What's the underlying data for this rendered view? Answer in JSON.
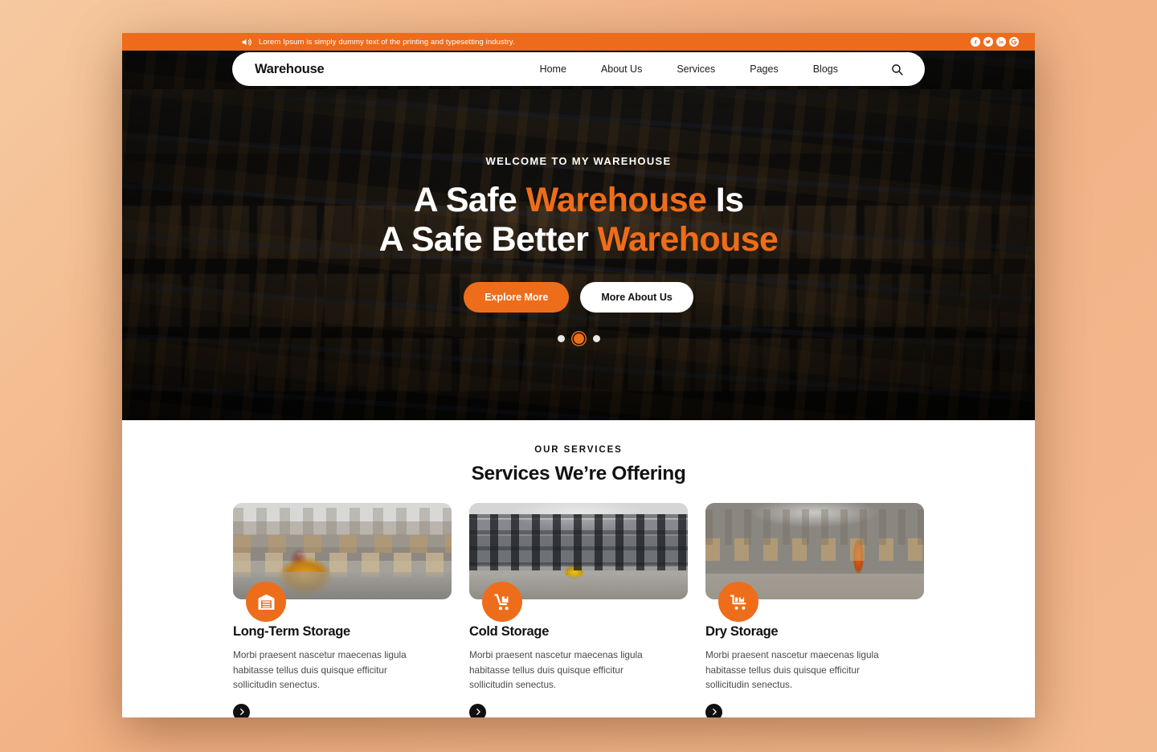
{
  "topbar": {
    "speaker_icon": "speaker-icon",
    "ticker": "Lorem Ipsum is simply dummy text of the printing and typesetting industry.",
    "background_color": "#ed6b1a",
    "socials": [
      {
        "name": "facebook",
        "glyph": "f"
      },
      {
        "name": "twitter",
        "glyph": "t"
      },
      {
        "name": "linkedin",
        "glyph": "in"
      },
      {
        "name": "google",
        "glyph": "G"
      }
    ]
  },
  "nav": {
    "brand": "Warehouse",
    "links": [
      {
        "label": "Home"
      },
      {
        "label": "About Us"
      },
      {
        "label": "Services"
      },
      {
        "label": "Pages"
      },
      {
        "label": "Blogs"
      }
    ],
    "search_icon": "search-icon"
  },
  "hero": {
    "eyebrow": "WELCOME TO MY WAREHOUSE",
    "title_line1_a": "A Safe ",
    "title_line1_hl": "Warehouse",
    "title_line1_b": " Is",
    "title_line2_a": "A Safe Better ",
    "title_line2_hl": "Warehouse",
    "primary_button": "Explore More",
    "secondary_button": "More About Us",
    "slide_count": 3,
    "active_slide": 2,
    "accent_color": "#ee6d1b"
  },
  "services": {
    "eyebrow": "OUR SERVICES",
    "title": "Services We’re Offering",
    "cards": [
      {
        "title": "Long-Term Storage",
        "desc": "Morbi praesent nascetur maecenas ligula habitasse tellus duis quisque efficitur sollicitudin senectus.",
        "badge_icon": "warehouse-icon",
        "arrow_icon": "chevron-right-icon"
      },
      {
        "title": "Cold Storage",
        "desc": "Morbi praesent nascetur maecenas ligula habitasse tellus duis quisque efficitur sollicitudin senectus.",
        "badge_icon": "hand-truck-icon",
        "arrow_icon": "chevron-right-icon"
      },
      {
        "title": "Dry Storage",
        "desc": "Morbi praesent nascetur maecenas ligula habitasse tellus duis quisque efficitur sollicitudin senectus.",
        "badge_icon": "cart-box-icon",
        "arrow_icon": "chevron-right-icon"
      }
    ]
  }
}
